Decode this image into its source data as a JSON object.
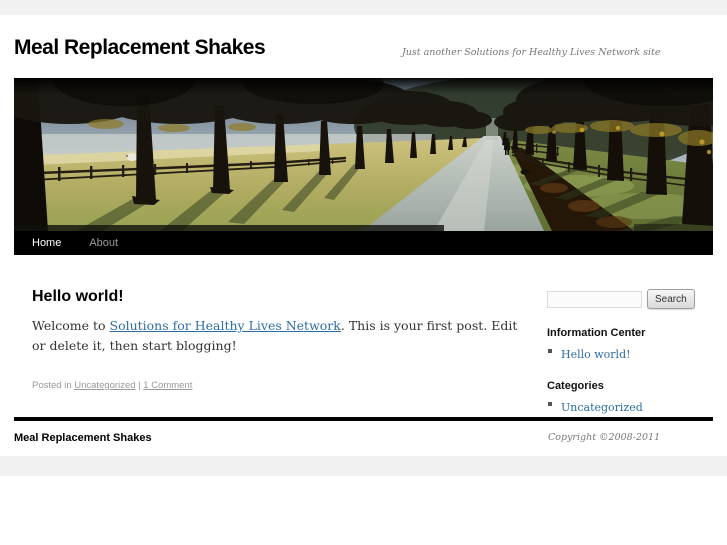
{
  "colors": {
    "link": "#2d6da3",
    "nav_bg": "#000000",
    "text": "#333333",
    "meta": "#999999",
    "strip": "#f1f1f1",
    "title": "#000000"
  },
  "header": {
    "site_title": "Meal Replacement Shakes",
    "tagline": "Just another Solutions for Healthy Lives Network site",
    "image_alt": "avenue-of-trees-header-photo"
  },
  "nav": {
    "items": [
      {
        "label": "Home",
        "current": true
      },
      {
        "label": "About",
        "current": false
      }
    ]
  },
  "post": {
    "title": "Hello world!",
    "body": {
      "prefix": "Welcome to ",
      "link": "Solutions for Healthy Lives Network",
      "suffix": ". This is your first post. Edit or delete it, then start blogging!"
    },
    "meta": {
      "prefix": "Posted in ",
      "category": "Uncategorized",
      "separator": " | ",
      "comments": "1 Comment"
    }
  },
  "sidebar": {
    "search": {
      "input_value": "",
      "button_label": "Search"
    },
    "sections": [
      {
        "title": "Information Center",
        "links": [
          "Hello world!"
        ]
      },
      {
        "title": "Categories",
        "links": [
          "Uncategorized"
        ]
      }
    ]
  },
  "footer": {
    "site_name": "Meal Replacement Shakes",
    "copyright": "Copyright ©2008-2011"
  }
}
